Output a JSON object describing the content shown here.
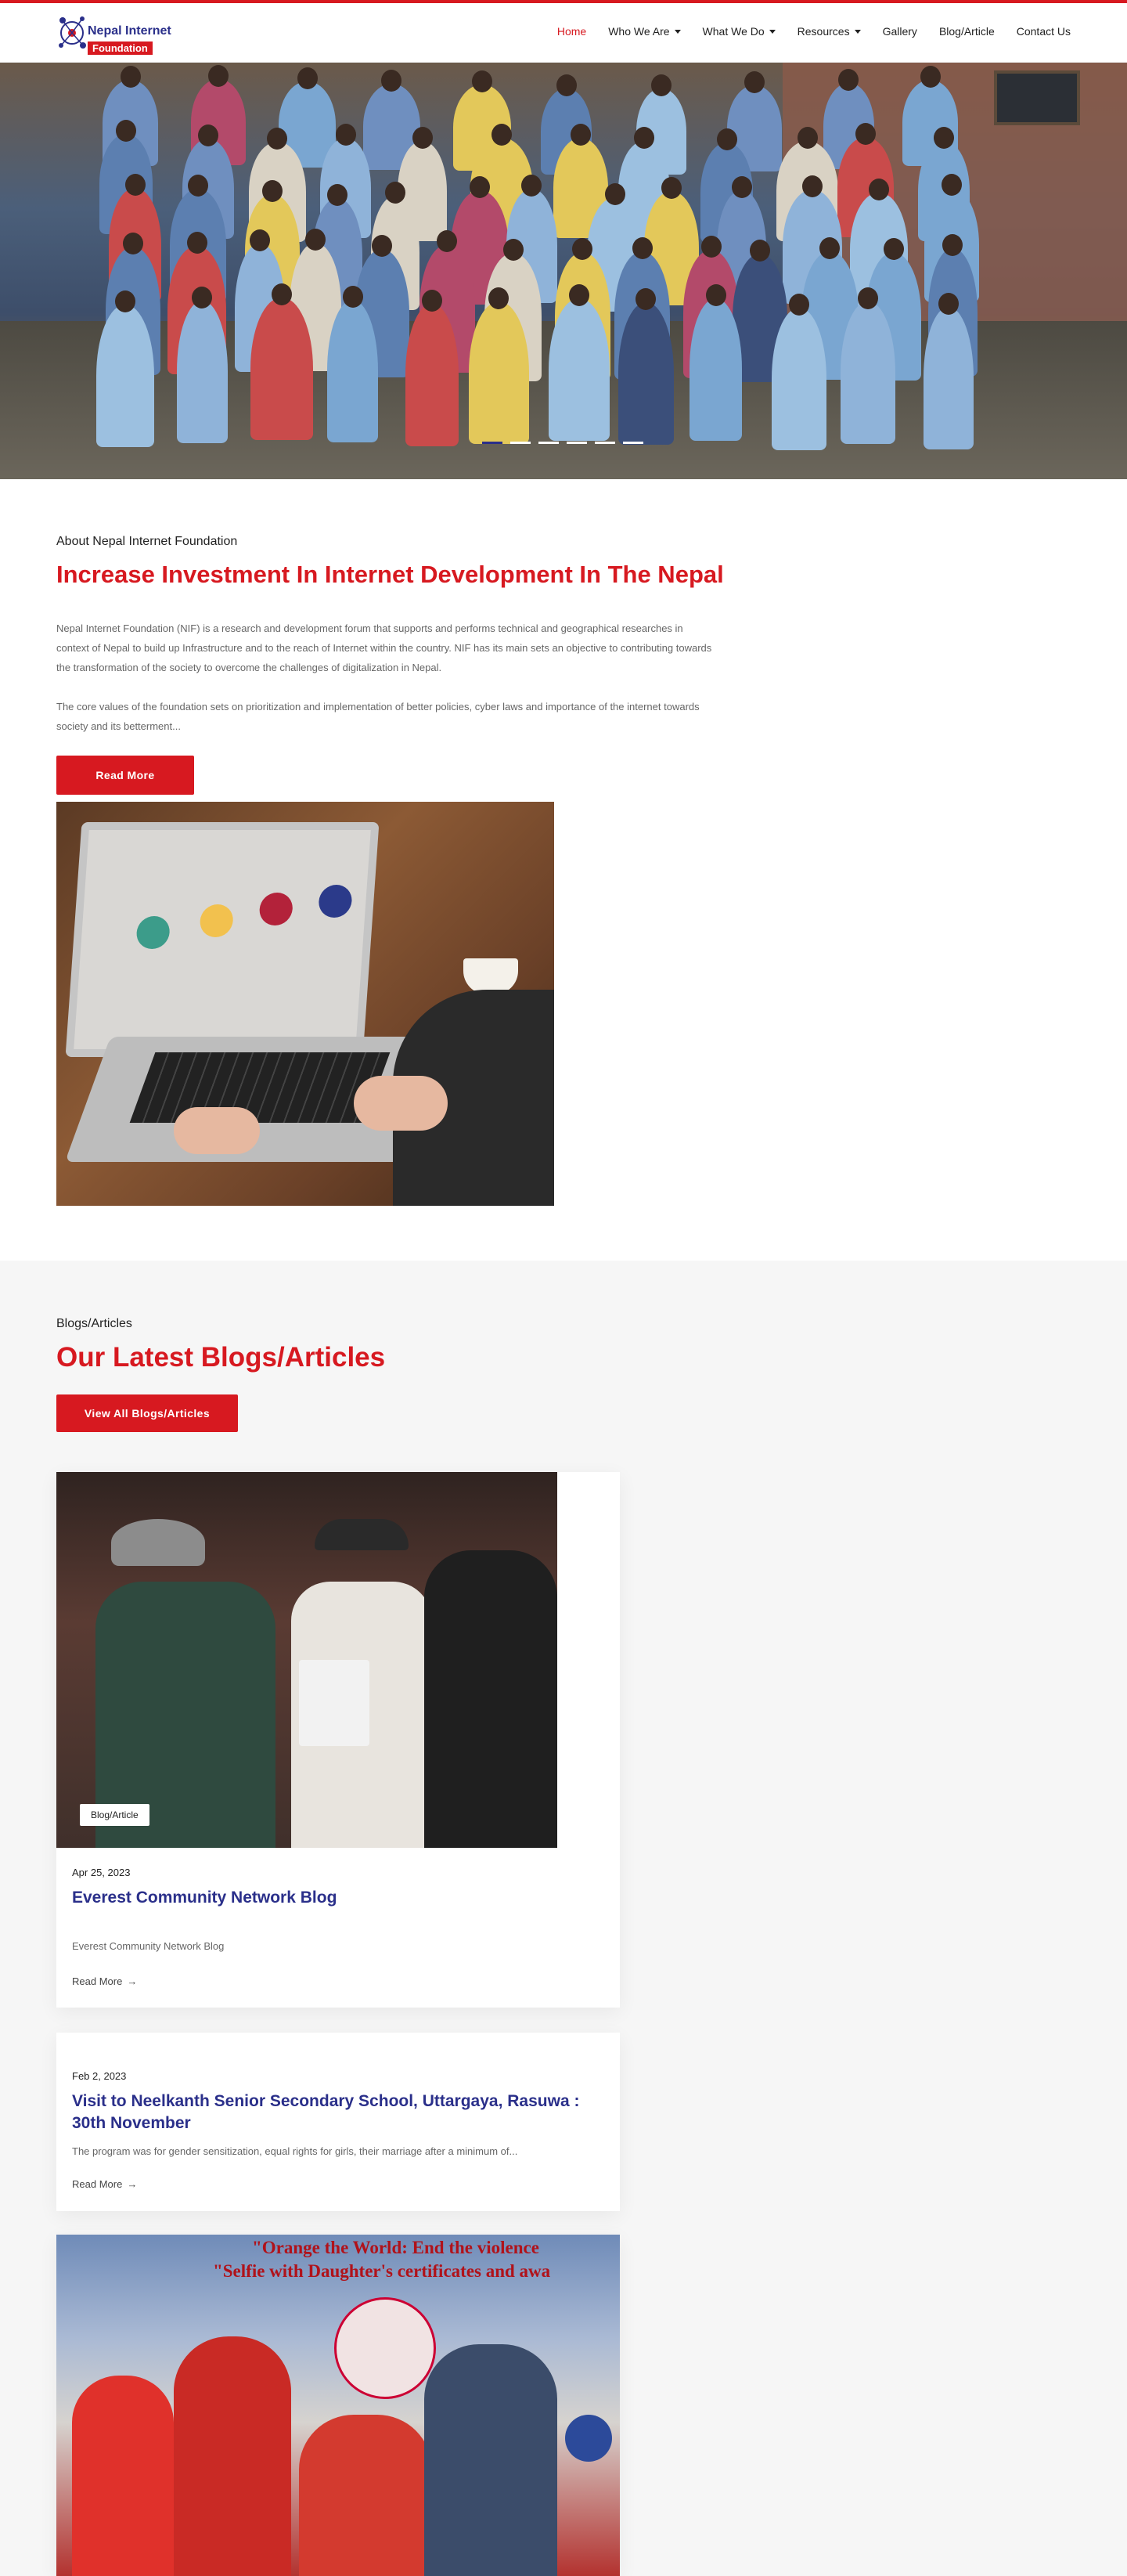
{
  "brand": {
    "name_line1": "Nepal Internet",
    "name_line2": "Foundation",
    "accent": "#d71920",
    "navy": "#2a2f8a"
  },
  "nav": {
    "items": [
      {
        "label": "Home",
        "active": true,
        "dropdown": false
      },
      {
        "label": "Who We Are",
        "active": false,
        "dropdown": true
      },
      {
        "label": "What We Do",
        "active": false,
        "dropdown": true
      },
      {
        "label": "Resources",
        "active": false,
        "dropdown": true
      },
      {
        "label": "Gallery",
        "active": false,
        "dropdown": false
      },
      {
        "label": "Blog/Article",
        "active": false,
        "dropdown": false
      },
      {
        "label": "Contact Us",
        "active": false,
        "dropdown": false
      }
    ]
  },
  "hero": {
    "slide_count": 6,
    "active_slide": 1
  },
  "about": {
    "eyebrow": "About Nepal Internet Foundation",
    "title": "Increase Investment In Internet Development In The Nepal",
    "p1": "Nepal Internet Foundation (NIF) is a research and development forum that supports and performs technical and geographical researches in context of Nepal to build up Infrastructure and to the reach of Internet within the country. NIF has its main sets an objective to contributing towards the transformation of the society to overcome the challenges of digitalization in Nepal.",
    "p2": "The core values of the foundation sets on prioritization and implementation of better policies, cyber laws and importance of the internet towards society and its betterment...",
    "button": "Read More"
  },
  "blogs": {
    "eyebrow": "Blogs/Articles",
    "title": "Our Latest Blogs/Articles",
    "button": "View All Blogs/Articles",
    "posts": [
      {
        "badge": "Blog/Article",
        "date": "Apr 25, 2023",
        "title": "Everest Community Network Blog",
        "excerpt": "Everest Community Network Blog",
        "read_more": "Read More"
      },
      {
        "date": "Feb 2, 2023",
        "title": "Visit to Neelkanth Senior Secondary School, Uttargaya, Rasuwa : 30th November",
        "excerpt": "The program was for gender sensitization, equal rights for girls, their marriage after a minimum of...",
        "read_more": "Read More"
      },
      {
        "image_banner_line1": "\"Orange the World: End the violence",
        "image_banner_line2": "\"Selfie with Daughter's certificates and awa"
      }
    ]
  }
}
